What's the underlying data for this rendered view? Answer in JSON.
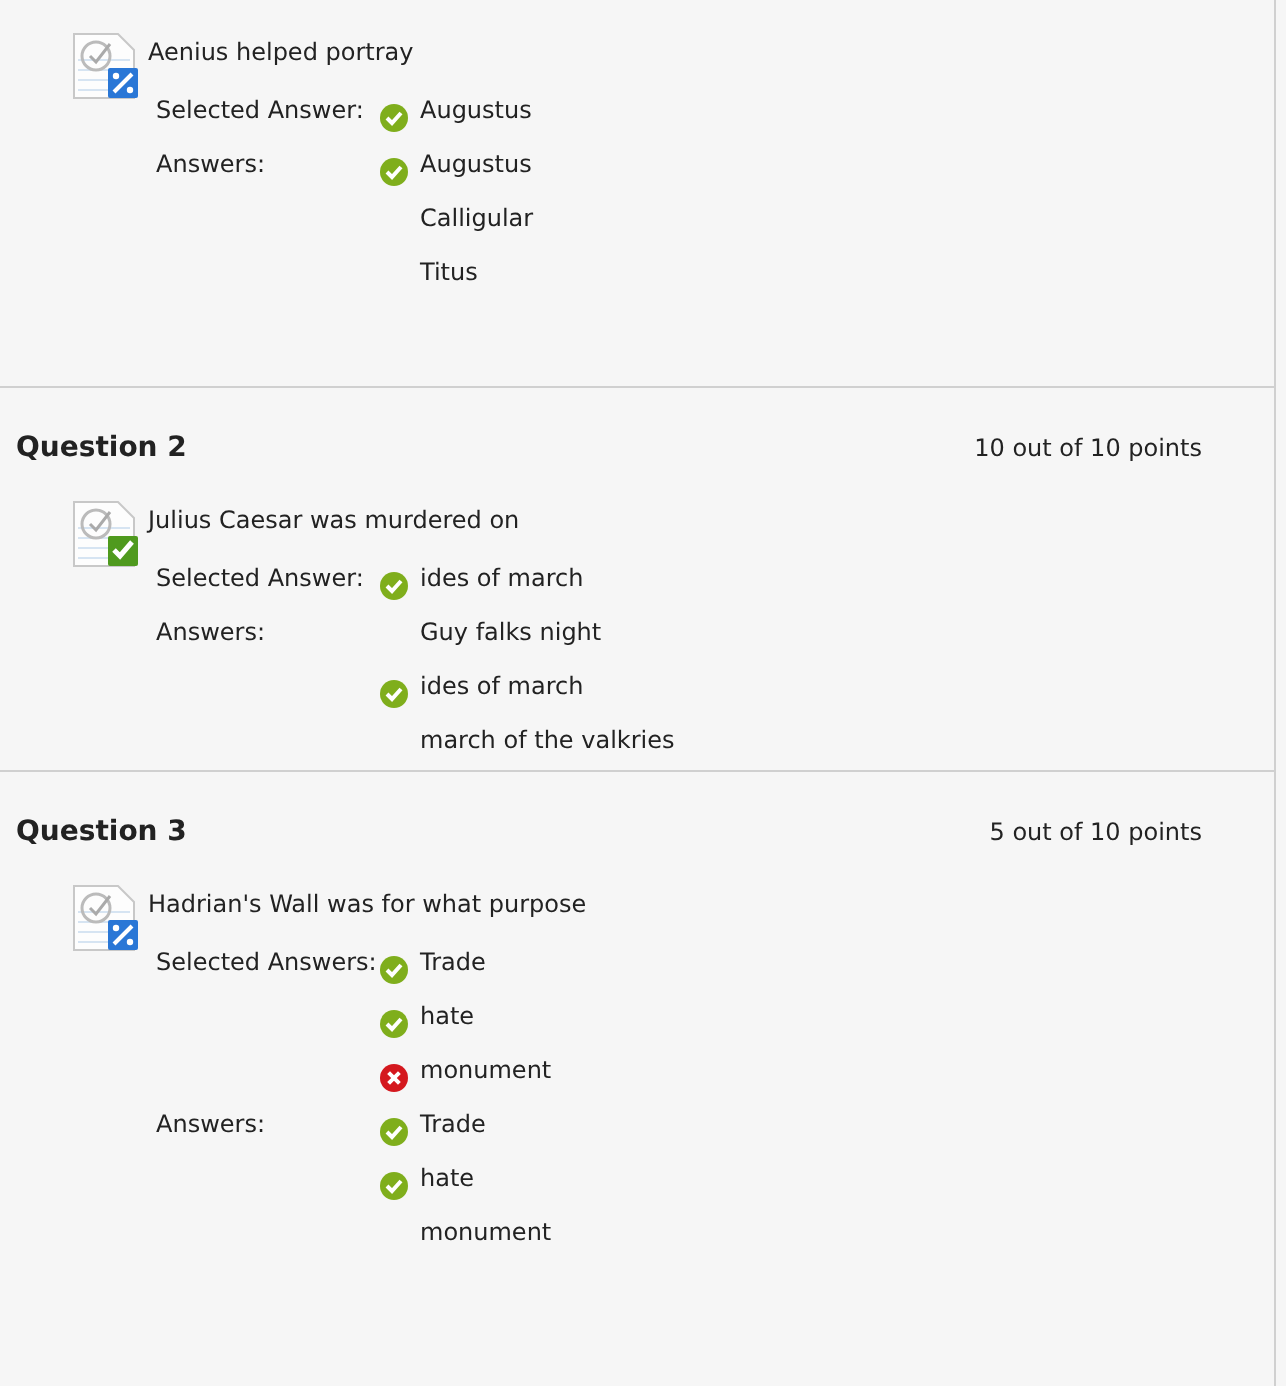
{
  "questions": [
    {
      "kind": "partial",
      "prompt": "Aenius helped portray",
      "groups": [
        {
          "label": "Selected Answer:",
          "items": [
            {
              "text": "Augustus",
              "kind": "correct"
            }
          ]
        },
        {
          "label": "Answers:",
          "items": [
            {
              "text": "Augustus",
              "kind": "correct"
            },
            {
              "text": "Calligular",
              "kind": "plain"
            },
            {
              "text": "Titus",
              "kind": "plain"
            }
          ]
        }
      ]
    },
    {
      "title": "Question 2",
      "points": "10 out of 10 points",
      "kind": "correct",
      "prompt": "Julius Caesar was murdered on",
      "groups": [
        {
          "label": "Selected Answer:",
          "items": [
            {
              "text": "ides of march",
              "kind": "correct"
            }
          ]
        },
        {
          "label": "Answers:",
          "items": [
            {
              "text": "Guy falks night",
              "kind": "plain"
            },
            {
              "text": "ides of march",
              "kind": "correct"
            },
            {
              "text": "march of the valkries",
              "kind": "plain"
            }
          ]
        }
      ]
    },
    {
      "title": "Question 3",
      "points": "5 out of 10 points",
      "kind": "partial",
      "prompt": "Hadrian's Wall was for what purpose",
      "groups": [
        {
          "label": "Selected Answers:",
          "items": [
            {
              "text": "Trade",
              "kind": "correct"
            },
            {
              "text": "hate",
              "kind": "correct"
            },
            {
              "text": "monument",
              "kind": "incorrect"
            }
          ]
        },
        {
          "label": "Answers:",
          "items": [
            {
              "text": "Trade",
              "kind": "correct"
            },
            {
              "text": "hate",
              "kind": "correct"
            },
            {
              "text": "monument",
              "kind": "plain"
            }
          ]
        }
      ]
    }
  ]
}
